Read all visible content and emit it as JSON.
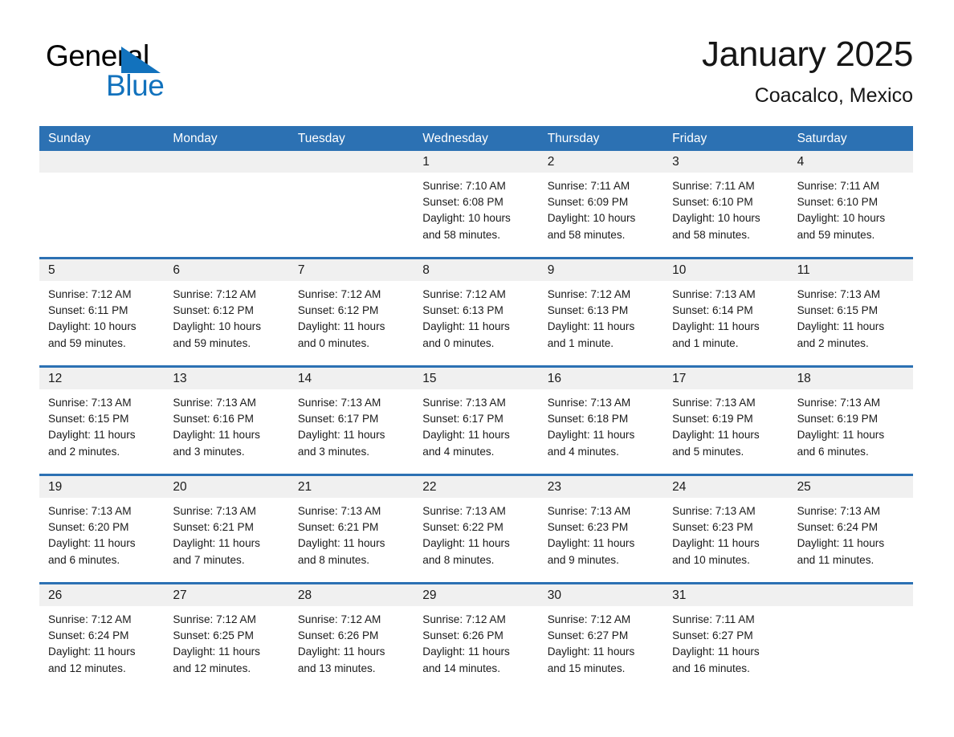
{
  "brand": {
    "name_part1": "General",
    "name_part2": "Blue",
    "triangle_icon": "triangle-icon",
    "black": "#000000",
    "blue": "#1272bd"
  },
  "header": {
    "month_title": "January 2025",
    "location": "Coacalco, Mexico"
  },
  "theme": {
    "header_blue": "#2c71b3",
    "daynum_gray": "#f0f0f0",
    "text": "#1a1a1a",
    "page_bg": "#ffffff"
  },
  "weekdays": [
    "Sunday",
    "Monday",
    "Tuesday",
    "Wednesday",
    "Thursday",
    "Friday",
    "Saturday"
  ],
  "weeks": [
    [
      {
        "day": "",
        "lines": []
      },
      {
        "day": "",
        "lines": []
      },
      {
        "day": "",
        "lines": []
      },
      {
        "day": "1",
        "lines": [
          "Sunrise: 7:10 AM",
          "Sunset: 6:08 PM",
          "Daylight: 10 hours",
          "and 58 minutes."
        ]
      },
      {
        "day": "2",
        "lines": [
          "Sunrise: 7:11 AM",
          "Sunset: 6:09 PM",
          "Daylight: 10 hours",
          "and 58 minutes."
        ]
      },
      {
        "day": "3",
        "lines": [
          "Sunrise: 7:11 AM",
          "Sunset: 6:10 PM",
          "Daylight: 10 hours",
          "and 58 minutes."
        ]
      },
      {
        "day": "4",
        "lines": [
          "Sunrise: 7:11 AM",
          "Sunset: 6:10 PM",
          "Daylight: 10 hours",
          "and 59 minutes."
        ]
      }
    ],
    [
      {
        "day": "5",
        "lines": [
          "Sunrise: 7:12 AM",
          "Sunset: 6:11 PM",
          "Daylight: 10 hours",
          "and 59 minutes."
        ]
      },
      {
        "day": "6",
        "lines": [
          "Sunrise: 7:12 AM",
          "Sunset: 6:12 PM",
          "Daylight: 10 hours",
          "and 59 minutes."
        ]
      },
      {
        "day": "7",
        "lines": [
          "Sunrise: 7:12 AM",
          "Sunset: 6:12 PM",
          "Daylight: 11 hours",
          "and 0 minutes."
        ]
      },
      {
        "day": "8",
        "lines": [
          "Sunrise: 7:12 AM",
          "Sunset: 6:13 PM",
          "Daylight: 11 hours",
          "and 0 minutes."
        ]
      },
      {
        "day": "9",
        "lines": [
          "Sunrise: 7:12 AM",
          "Sunset: 6:13 PM",
          "Daylight: 11 hours",
          "and 1 minute."
        ]
      },
      {
        "day": "10",
        "lines": [
          "Sunrise: 7:13 AM",
          "Sunset: 6:14 PM",
          "Daylight: 11 hours",
          "and 1 minute."
        ]
      },
      {
        "day": "11",
        "lines": [
          "Sunrise: 7:13 AM",
          "Sunset: 6:15 PM",
          "Daylight: 11 hours",
          "and 2 minutes."
        ]
      }
    ],
    [
      {
        "day": "12",
        "lines": [
          "Sunrise: 7:13 AM",
          "Sunset: 6:15 PM",
          "Daylight: 11 hours",
          "and 2 minutes."
        ]
      },
      {
        "day": "13",
        "lines": [
          "Sunrise: 7:13 AM",
          "Sunset: 6:16 PM",
          "Daylight: 11 hours",
          "and 3 minutes."
        ]
      },
      {
        "day": "14",
        "lines": [
          "Sunrise: 7:13 AM",
          "Sunset: 6:17 PM",
          "Daylight: 11 hours",
          "and 3 minutes."
        ]
      },
      {
        "day": "15",
        "lines": [
          "Sunrise: 7:13 AM",
          "Sunset: 6:17 PM",
          "Daylight: 11 hours",
          "and 4 minutes."
        ]
      },
      {
        "day": "16",
        "lines": [
          "Sunrise: 7:13 AM",
          "Sunset: 6:18 PM",
          "Daylight: 11 hours",
          "and 4 minutes."
        ]
      },
      {
        "day": "17",
        "lines": [
          "Sunrise: 7:13 AM",
          "Sunset: 6:19 PM",
          "Daylight: 11 hours",
          "and 5 minutes."
        ]
      },
      {
        "day": "18",
        "lines": [
          "Sunrise: 7:13 AM",
          "Sunset: 6:19 PM",
          "Daylight: 11 hours",
          "and 6 minutes."
        ]
      }
    ],
    [
      {
        "day": "19",
        "lines": [
          "Sunrise: 7:13 AM",
          "Sunset: 6:20 PM",
          "Daylight: 11 hours",
          "and 6 minutes."
        ]
      },
      {
        "day": "20",
        "lines": [
          "Sunrise: 7:13 AM",
          "Sunset: 6:21 PM",
          "Daylight: 11 hours",
          "and 7 minutes."
        ]
      },
      {
        "day": "21",
        "lines": [
          "Sunrise: 7:13 AM",
          "Sunset: 6:21 PM",
          "Daylight: 11 hours",
          "and 8 minutes."
        ]
      },
      {
        "day": "22",
        "lines": [
          "Sunrise: 7:13 AM",
          "Sunset: 6:22 PM",
          "Daylight: 11 hours",
          "and 8 minutes."
        ]
      },
      {
        "day": "23",
        "lines": [
          "Sunrise: 7:13 AM",
          "Sunset: 6:23 PM",
          "Daylight: 11 hours",
          "and 9 minutes."
        ]
      },
      {
        "day": "24",
        "lines": [
          "Sunrise: 7:13 AM",
          "Sunset: 6:23 PM",
          "Daylight: 11 hours",
          "and 10 minutes."
        ]
      },
      {
        "day": "25",
        "lines": [
          "Sunrise: 7:13 AM",
          "Sunset: 6:24 PM",
          "Daylight: 11 hours",
          "and 11 minutes."
        ]
      }
    ],
    [
      {
        "day": "26",
        "lines": [
          "Sunrise: 7:12 AM",
          "Sunset: 6:24 PM",
          "Daylight: 11 hours",
          "and 12 minutes."
        ]
      },
      {
        "day": "27",
        "lines": [
          "Sunrise: 7:12 AM",
          "Sunset: 6:25 PM",
          "Daylight: 11 hours",
          "and 12 minutes."
        ]
      },
      {
        "day": "28",
        "lines": [
          "Sunrise: 7:12 AM",
          "Sunset: 6:26 PM",
          "Daylight: 11 hours",
          "and 13 minutes."
        ]
      },
      {
        "day": "29",
        "lines": [
          "Sunrise: 7:12 AM",
          "Sunset: 6:26 PM",
          "Daylight: 11 hours",
          "and 14 minutes."
        ]
      },
      {
        "day": "30",
        "lines": [
          "Sunrise: 7:12 AM",
          "Sunset: 6:27 PM",
          "Daylight: 11 hours",
          "and 15 minutes."
        ]
      },
      {
        "day": "31",
        "lines": [
          "Sunrise: 7:11 AM",
          "Sunset: 6:27 PM",
          "Daylight: 11 hours",
          "and 16 minutes."
        ]
      },
      {
        "day": "",
        "lines": []
      }
    ]
  ]
}
